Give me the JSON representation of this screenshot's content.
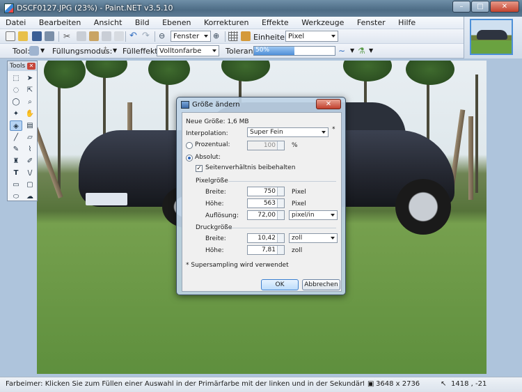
{
  "window": {
    "title": "DSCF0127.JPG (23%) - Paint.NET v3.5.10",
    "min_glyph": "–",
    "max_glyph": "□",
    "close_glyph": "✕"
  },
  "menu": [
    "Datei",
    "Bearbeiten",
    "Ansicht",
    "Bild",
    "Ebenen",
    "Korrekturen",
    "Effekte",
    "Werkzeuge",
    "Fenster",
    "Hilfe"
  ],
  "toolbar1": {
    "zoom_value": "Fenster",
    "units_label": "Einheiten:",
    "units_value": "Pixel"
  },
  "toolbar2": {
    "tool_label": "Tool:",
    "fill_mode_label": "Füllungsmodus:",
    "fill_effect_label": "Fülleffekt:",
    "fill_effect_value": "Volltonfarbe",
    "tolerance_label": "Toleranz:",
    "tolerance_value": "50%",
    "tolerance_fraction": 0.5
  },
  "tools_panel": {
    "title": "Tools",
    "icons": [
      "rect-select-icon",
      "move-selection-icon",
      "lasso-select-icon",
      "move-selection-alt-icon",
      "ellipse-select-icon",
      "zoom-icon",
      "magic-wand-icon",
      "pan-icon",
      "paint-bucket-icon",
      "gradient-icon",
      "paintbrush-icon",
      "eraser-icon",
      "pencil-icon",
      "color-picker-icon",
      "clone-stamp-icon",
      "recolor-icon",
      "text-icon",
      "line-curve-icon",
      "rectangle-icon",
      "rounded-rectangle-icon",
      "ellipse-icon",
      "freeform-shape-icon"
    ]
  },
  "dialog": {
    "title": "Größe ändern",
    "new_size": "Neue Größe: 1,6 MB",
    "interpolation_label": "Interpolation:",
    "interpolation_value": "Super Fein",
    "percent_label": "Prozentual:",
    "percent_value": "100",
    "percent_unit": "%",
    "absolute_label": "Absolut:",
    "keep_ratio_label": "Seitenverhältnis beibehalten",
    "pixel_size_heading": "Pixelgröße",
    "width_label": "Breite:",
    "width_value": "750",
    "width_unit": "Pixel",
    "height_label": "Höhe:",
    "height_value": "563",
    "height_unit": "Pixel",
    "resolution_label": "Auflösung:",
    "resolution_value": "72,00",
    "resolution_unit": "pixel/in",
    "print_size_heading": "Druckgröße",
    "print_width_label": "Breite:",
    "print_width_value": "10,42",
    "print_width_unit": "zoll",
    "print_height_label": "Höhe:",
    "print_height_value": "7,81",
    "print_height_unit": "zoll",
    "supersampling_note": "* Supersampling wird verwendet",
    "ok_label": "OK",
    "cancel_label": "Abbrechen"
  },
  "status": {
    "message": "Farbeimer: Klicken Sie zum Füllen einer Auswahl in der Primärfarbe mit der linken und in der Sekundärfarbe mit der rechten M",
    "image_size": "3648 x 2736",
    "cursor": "1418 , -21"
  }
}
